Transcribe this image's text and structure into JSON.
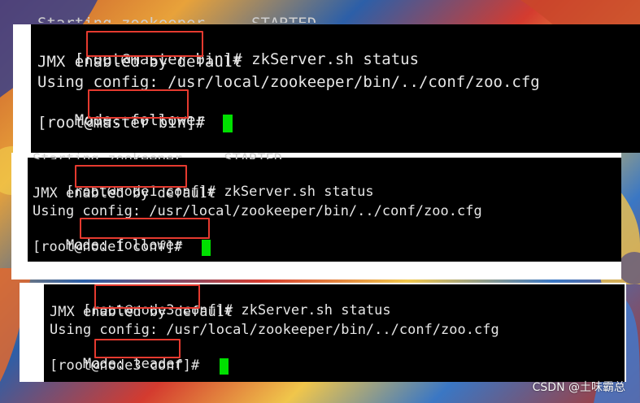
{
  "terminals": [
    {
      "ghost": "Starting zookeeper ... STARTED",
      "prompt": "[root@master bin]# ",
      "command": "zkServer.sh status",
      "lines": [
        "JMX enabled by default",
        "Using config: /usr/local/zookeeper/bin/../conf/zoo.cfg"
      ],
      "mode_label": "Mode: ",
      "mode_value": "follower",
      "final_prompt": "[root@master bin]# "
    },
    {
      "ghost": "Starting zookeeper ... STARTED",
      "prompt": "[root@node1 conf]# ",
      "command": "zkServer.sh status",
      "lines": [
        "JMX enabled by default",
        "Using config: /usr/local/zookeeper/bin/../conf/zoo.cfg"
      ],
      "mode_label": "Mode: ",
      "mode_value": "follower",
      "final_prompt": "[root@node1 conf]# "
    },
    {
      "prompt": "[root@node3 conf]# ",
      "command": "zkServer.sh status",
      "lines": [
        "JMX enabled by default",
        "Using config: /usr/local/zookeeper/bin/../conf/zoo.cfg"
      ],
      "mode_label": "Mode: ",
      "mode_value": "leader",
      "final_prompt": "[root@node3 conf]# "
    }
  ],
  "watermark": "CSDN @土味霸总",
  "colors": {
    "highlight": "#e53a2f",
    "cursor": "#00e000",
    "terminal_bg": "#000000",
    "text": "#e6e6e6"
  }
}
